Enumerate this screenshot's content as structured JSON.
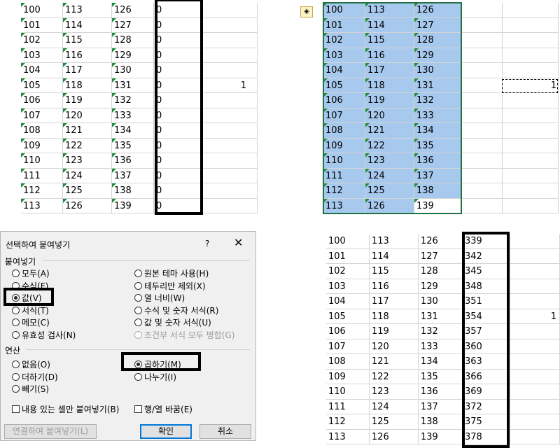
{
  "top_left": {
    "col_a": [
      "100",
      "101",
      "102",
      "103",
      "104",
      "105",
      "106",
      "107",
      "108",
      "109",
      "110",
      "111",
      "112",
      "113"
    ],
    "col_b": [
      "113",
      "114",
      "115",
      "116",
      "117",
      "118",
      "119",
      "120",
      "121",
      "122",
      "123",
      "124",
      "125",
      "126"
    ],
    "col_c": [
      "126",
      "127",
      "128",
      "129",
      "130",
      "131",
      "132",
      "133",
      "134",
      "135",
      "136",
      "137",
      "138",
      "139"
    ],
    "col_d": [
      "0",
      "0",
      "0",
      "0",
      "0",
      "0",
      "0",
      "0",
      "0",
      "0",
      "0",
      "0",
      "0",
      "0"
    ],
    "extra_value": "1"
  },
  "top_right": {
    "col_a": [
      "100",
      "101",
      "102",
      "103",
      "104",
      "105",
      "106",
      "107",
      "108",
      "109",
      "110",
      "111",
      "112",
      "113"
    ],
    "col_b": [
      "113",
      "114",
      "115",
      "116",
      "117",
      "118",
      "119",
      "120",
      "121",
      "122",
      "123",
      "124",
      "125",
      "126"
    ],
    "col_c": [
      "126",
      "127",
      "128",
      "129",
      "130",
      "131",
      "132",
      "133",
      "134",
      "135",
      "136",
      "137",
      "138",
      "139"
    ],
    "copied_value": "1",
    "paste_icon": "paste-options-icon"
  },
  "dialog": {
    "title": "선택하여 붙여넣기",
    "help": "?",
    "close": "✕",
    "paste_section": "붙여넣기",
    "paste_options_left": [
      "모두(A)",
      "수식(F)",
      "값(V)",
      "서식(T)",
      "메모(C)",
      "유효성 검사(N)"
    ],
    "paste_options_right": [
      "원본 테마 사용(H)",
      "테두리만 제외(X)",
      "열 너비(W)",
      "수식 및 숫자 서식(R)",
      "값 및 숫자 서식(U)",
      "조건부 서식 모두 병합(G)"
    ],
    "selected_paste": "값(V)",
    "operation_section": "연산",
    "operation_left": [
      "없음(O)",
      "더하기(D)",
      "빼기(S)"
    ],
    "operation_right": [
      "곱하기(M)",
      "나누기(I)"
    ],
    "selected_operation": "곱하기(M)",
    "skip_blanks": "내용 있는 셀만 붙여넣기(B)",
    "transpose": "행/열 바꿈(E)",
    "paste_link": "연결하여 붙여넣기(L)",
    "ok": "확인",
    "cancel": "취소"
  },
  "bottom_right": {
    "col_a": [
      "100",
      "101",
      "102",
      "103",
      "104",
      "105",
      "106",
      "107",
      "108",
      "109",
      "110",
      "111",
      "112",
      "113"
    ],
    "col_b": [
      "113",
      "114",
      "115",
      "116",
      "117",
      "118",
      "119",
      "120",
      "121",
      "122",
      "123",
      "124",
      "125",
      "126"
    ],
    "col_c": [
      "126",
      "127",
      "128",
      "129",
      "130",
      "131",
      "132",
      "133",
      "134",
      "135",
      "136",
      "137",
      "138",
      "139"
    ],
    "col_d": [
      "339",
      "342",
      "345",
      "348",
      "351",
      "354",
      "357",
      "360",
      "363",
      "366",
      "369",
      "372",
      "375",
      "378"
    ],
    "extra_value": "1"
  }
}
